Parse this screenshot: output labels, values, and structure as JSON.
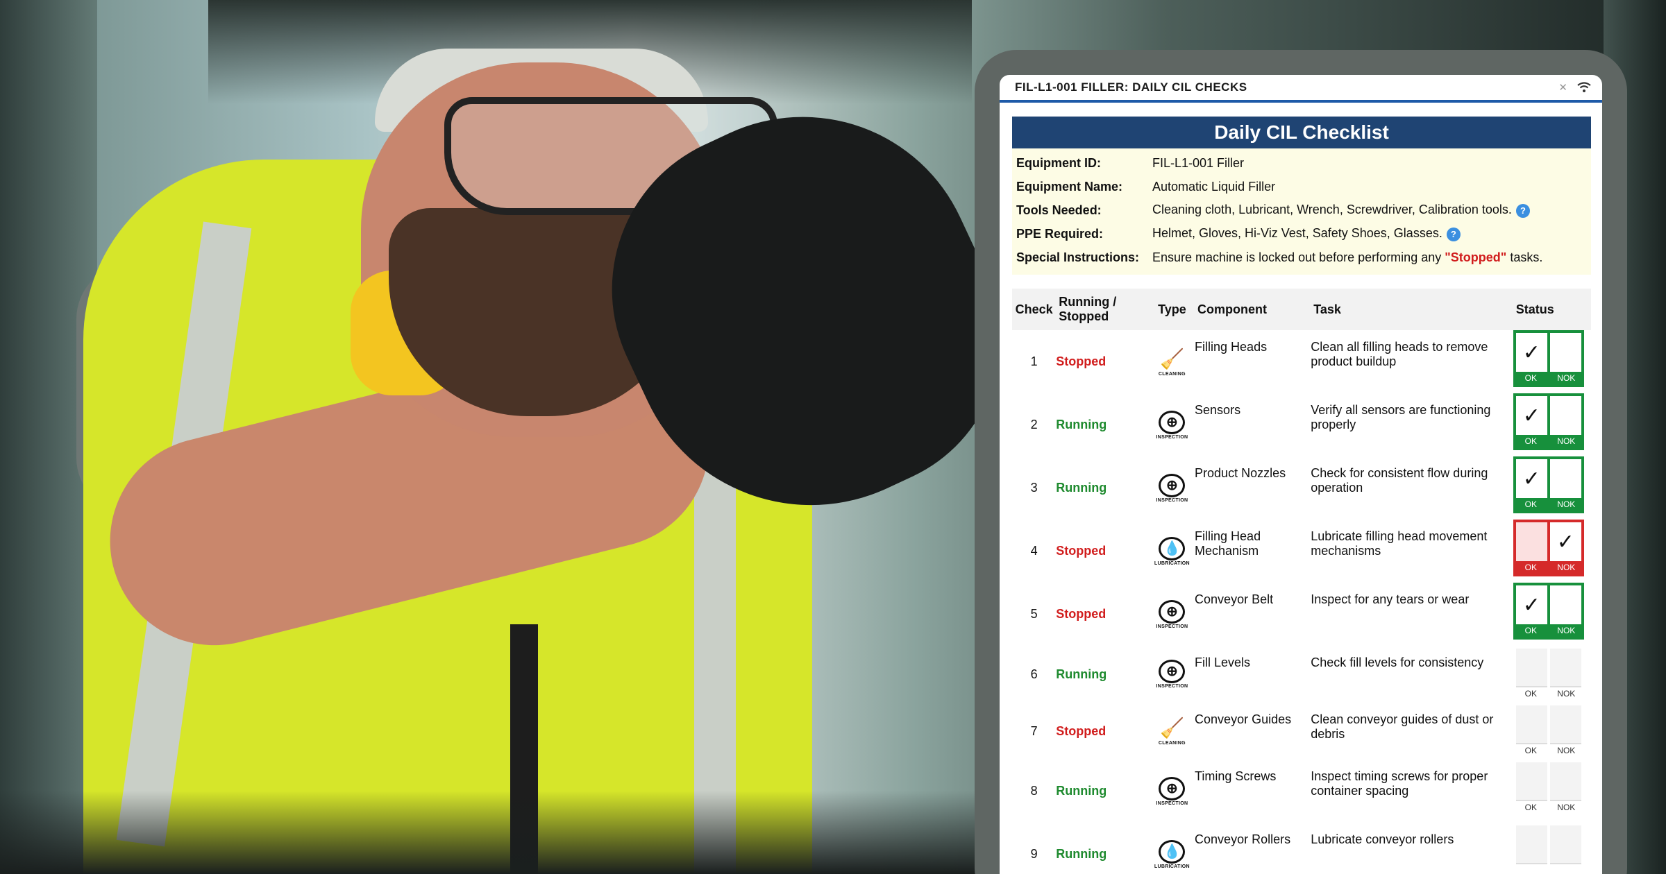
{
  "window": {
    "title": "FIL-L1-001 FILLER: DAILY CIL CHECKS"
  },
  "header": {
    "title": "Daily CIL Checklist"
  },
  "info": [
    {
      "key": "Equipment ID:",
      "value": "FIL-L1-001 Filler"
    },
    {
      "key": "Equipment Name:",
      "value": "Automatic Liquid Filler"
    },
    {
      "key": "Tools Needed:",
      "value": "Cleaning cloth, Lubricant, Wrench, Screwdriver, Calibration tools."
    },
    {
      "key": "PPE Required:",
      "value": "Helmet, Gloves, Hi-Viz Vest, Safety Shoes, Glasses."
    },
    {
      "key": "Special Instructions:",
      "value_prefix": "Ensure machine is locked out before performing any",
      "value_highlight": "\"Stopped\"",
      "value_suffix": "tasks."
    }
  ],
  "columns": {
    "check": "Check",
    "running_stopped": "Running / Stopped",
    "type": "Type",
    "component": "Component",
    "task": "Task",
    "status": "Status"
  },
  "status_labels": {
    "ok": "OK",
    "nok": "NOK"
  },
  "type_captions": {
    "cleaning": "CLEANING",
    "inspection": "INSPECTION",
    "lubrication": "LUBRICATION"
  },
  "rows": [
    {
      "check": "1",
      "state": "Stopped",
      "type": "cleaning",
      "component": "Filling Heads",
      "task": "Clean all filling heads to remove product buildup",
      "status": "ok"
    },
    {
      "check": "2",
      "state": "Running",
      "type": "inspection",
      "component": "Sensors",
      "task": "Verify all sensors are functioning properly",
      "status": "ok"
    },
    {
      "check": "3",
      "state": "Running",
      "type": "inspection",
      "component": "Product Nozzles",
      "task": "Check for consistent flow during operation",
      "status": "ok"
    },
    {
      "check": "4",
      "state": "Stopped",
      "type": "lubrication",
      "component": "Filling Head Mechanism",
      "task": "Lubricate filling head movement mechanisms",
      "status": "nok"
    },
    {
      "check": "5",
      "state": "Stopped",
      "type": "inspection",
      "component": "Conveyor Belt",
      "task": "Inspect for any tears or wear",
      "status": "ok"
    },
    {
      "check": "6",
      "state": "Running",
      "type": "inspection",
      "component": "Fill Levels",
      "task": "Check fill levels for consistency",
      "status": "empty"
    },
    {
      "check": "7",
      "state": "Stopped",
      "type": "cleaning",
      "component": "Conveyor Guides",
      "task": "Clean conveyor guides of dust or debris",
      "status": "empty"
    },
    {
      "check": "8",
      "state": "Running",
      "type": "inspection",
      "component": "Timing Screws",
      "task": "Inspect timing screws for proper container spacing",
      "status": "empty"
    },
    {
      "check": "9",
      "state": "Running",
      "type": "lubrication",
      "component": "Conveyor Rollers",
      "task": "Lubricate conveyor rollers",
      "status": "empty"
    }
  ],
  "colors": {
    "header_bg": "#1f4473",
    "ok_green": "#17903c",
    "nok_red": "#d52a2a",
    "stopped": "#d11d1d",
    "running": "#1e8a2e",
    "info_bg": "#fdfce5"
  }
}
